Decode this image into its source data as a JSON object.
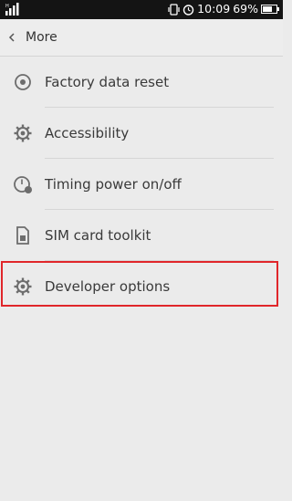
{
  "status_bar": {
    "time": "10:09",
    "battery_percent": "69%",
    "battery_level": 0.69,
    "icons": [
      "signal-icon",
      "vibrate-icon",
      "alarm-icon",
      "battery-icon"
    ]
  },
  "header": {
    "back_icon": "chevron-left-icon",
    "title": "More"
  },
  "menu": {
    "items": [
      {
        "label": "Factory data reset",
        "icon": "reset-icon"
      },
      {
        "label": "Accessibility",
        "icon": "gear-icon"
      },
      {
        "label": "Timing power on/off",
        "icon": "clock-power-icon"
      },
      {
        "label": "SIM card toolkit",
        "icon": "sim-card-icon"
      },
      {
        "label": "Developer options",
        "icon": "gear-icon"
      }
    ]
  },
  "colors": {
    "status_bar_bg": "#141414",
    "background": "#ebebeb",
    "highlight_border": "#e0262a",
    "text": "#3a3a3a"
  }
}
